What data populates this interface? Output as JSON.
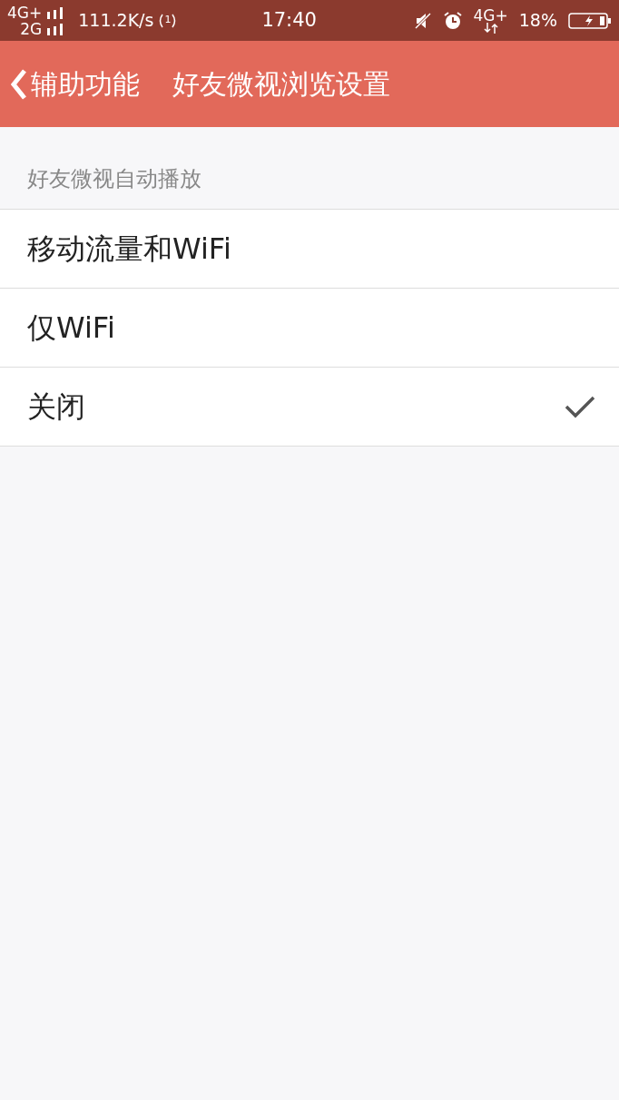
{
  "status_bar": {
    "network_1": "4G+",
    "network_2": "2G",
    "speed": "111.2K/s",
    "hotspot_count": "1",
    "time": "17:40",
    "data_network": "4G+",
    "battery": "18%"
  },
  "nav": {
    "back": "辅助功能",
    "title": "好友微视浏览设置"
  },
  "section": {
    "header": "好友微视自动播放",
    "options": [
      {
        "label": "移动流量和WiFi",
        "selected": false
      },
      {
        "label": "仅WiFi",
        "selected": false
      },
      {
        "label": "关闭",
        "selected": true
      }
    ]
  }
}
